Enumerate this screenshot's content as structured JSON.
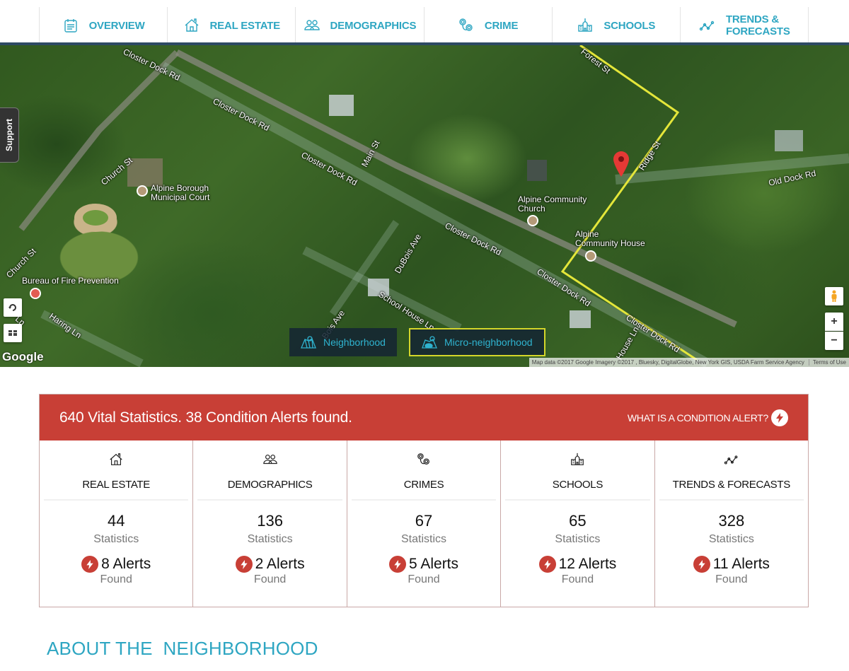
{
  "nav": {
    "items": [
      {
        "label": "OVERVIEW",
        "icon": "calendar-icon"
      },
      {
        "label": "REAL ESTATE",
        "icon": "house-icon"
      },
      {
        "label": "DEMOGRAPHICS",
        "icon": "people-icon"
      },
      {
        "label": "CRIME",
        "icon": "handcuffs-icon"
      },
      {
        "label": "SCHOOLS",
        "icon": "school-icon"
      },
      {
        "label": "TRENDS & FORECASTS",
        "icon": "trend-line-icon"
      }
    ]
  },
  "map": {
    "support_label": "Support",
    "labels": {
      "closter1": "Closter Dock Rd",
      "closter2": "Closter Dock Rd",
      "closter3": "Closter Dock Rd",
      "closter4": "Closter Dock Rd",
      "closter5": "Closter Dock Rd",
      "closter6": "Closter Dock Rd",
      "main_st": "Main St",
      "church_st1": "Church St",
      "church_st2": "Church St",
      "forest_st": "Forest St",
      "ridge_st": "Ridge St",
      "old_dock": "Old Dock Rd",
      "dubois1": "DuBois Ave",
      "dubois2": "Bois Ave",
      "school_house": "School House Ln",
      "house_ln": "House Ln",
      "haring": "Haring Ln",
      "ln": "Ln",
      "court": "Alpine Borough\nMunicipal Court",
      "court_l1": "Alpine Borough",
      "court_l2": "Municipal Court",
      "church_l1": "Alpine Community",
      "church_l2": "Church",
      "house_l1": "Alpine",
      "house_l2": "Community House",
      "fire": "Bureau of Fire Prevention"
    },
    "toggle": {
      "neighborhood": "Neighborhood",
      "micro": "Micro-neighborhood",
      "active": "micro"
    },
    "google_logo": "Google",
    "attribution": "Map data ©2017 Google Imagery ©2017 , Bluesky, DigitalGlobe, New York GIS, USDA Farm Service Agency",
    "terms": "Terms of Use",
    "zoom_in": "+",
    "zoom_out": "−"
  },
  "stats": {
    "headline": "640 Vital Statistics. 38 Condition Alerts found.",
    "help_link": "WHAT IS A CONDITION ALERT?",
    "stat_label": "Statistics",
    "found_label": "Found",
    "categories": [
      {
        "title": "REAL ESTATE",
        "count": "44",
        "alerts": "8 Alerts",
        "icon": "house-icon"
      },
      {
        "title": "DEMOGRAPHICS",
        "count": "136",
        "alerts": "2 Alerts",
        "icon": "people-icon"
      },
      {
        "title": "CRIMES",
        "count": "67",
        "alerts": "5 Alerts",
        "icon": "handcuffs-icon"
      },
      {
        "title": "SCHOOLS",
        "count": "65",
        "alerts": "12 Alerts",
        "icon": "school-icon"
      },
      {
        "title": "TRENDS & FORECASTS",
        "count": "328",
        "alerts": "11 Alerts",
        "icon": "trend-line-icon"
      }
    ]
  },
  "about": {
    "heading": "ABOUT THE  NEIGHBORHOOD"
  },
  "colors": {
    "accent": "#2ea6c2",
    "alert": "#c83f36",
    "nav_line": "#2d4a63",
    "route": "#e4e63a"
  }
}
